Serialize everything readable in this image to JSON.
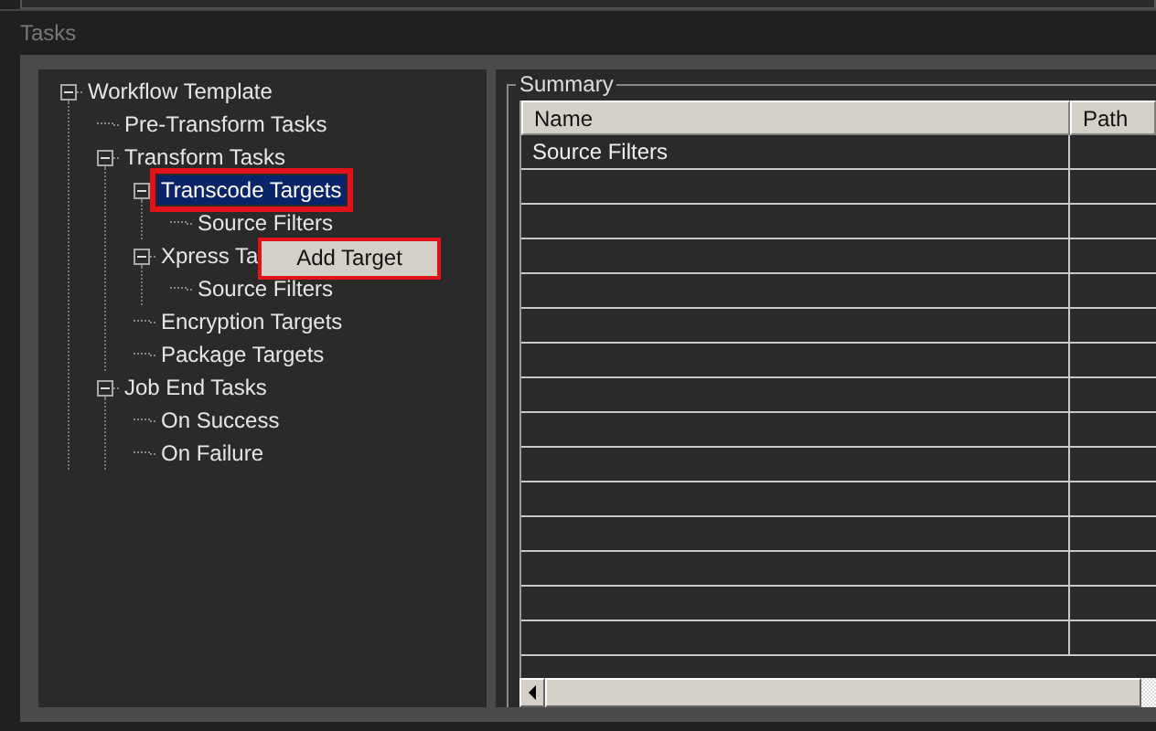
{
  "section_title": "Tasks",
  "tree": [
    {
      "label": "Workflow Template",
      "expanded": true,
      "selected": false,
      "outlined": false,
      "children": [
        {
          "label": "Pre-Transform Tasks",
          "selected": false,
          "outlined": false
        },
        {
          "label": "Transform Tasks",
          "expanded": true,
          "selected": false,
          "outlined": false,
          "children": [
            {
              "label": "Transcode Targets",
              "expanded": true,
              "selected": true,
              "outlined": true,
              "children": [
                {
                  "label": "Source Filters",
                  "selected": false,
                  "outlined": false
                }
              ]
            },
            {
              "label": "Xpress Ta",
              "expanded": true,
              "selected": false,
              "outlined": false,
              "children": [
                {
                  "label": "Source Filters",
                  "selected": false,
                  "outlined": false
                }
              ]
            },
            {
              "label": "Encryption Targets",
              "selected": false,
              "outlined": false
            },
            {
              "label": "Package Targets",
              "selected": false,
              "outlined": false
            }
          ]
        },
        {
          "label": "Job End Tasks",
          "expanded": true,
          "selected": false,
          "outlined": false,
          "children": [
            {
              "label": "On Success",
              "selected": false,
              "outlined": false
            },
            {
              "label": "On Failure",
              "selected": false,
              "outlined": false
            }
          ]
        }
      ]
    }
  ],
  "context_menu": {
    "items": [
      {
        "label": "Add Target",
        "outlined": true
      }
    ]
  },
  "summary": {
    "title": "Summary",
    "columns": [
      "Name",
      "Path"
    ],
    "rows": [
      [
        "Source Filters",
        ""
      ]
    ]
  }
}
